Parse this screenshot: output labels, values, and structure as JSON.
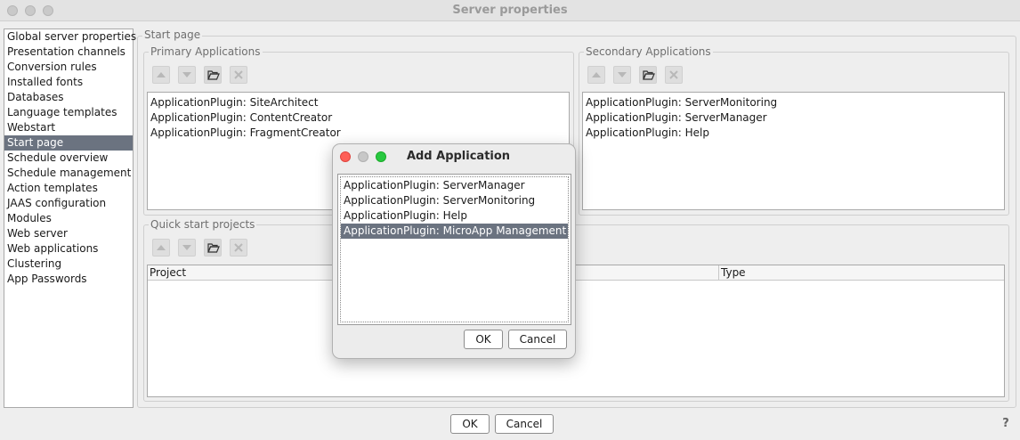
{
  "window": {
    "title": "Server properties"
  },
  "nav": {
    "items": [
      "Global server properties",
      "Presentation channels",
      "Conversion rules",
      "Installed fonts",
      "Databases",
      "Language templates",
      "Webstart",
      "Start page",
      "Schedule overview",
      "Schedule management",
      "Action templates",
      "JAAS configuration",
      "Modules",
      "Web server",
      "Web applications",
      "Clustering",
      "App Passwords"
    ],
    "selected_index": 7
  },
  "start_page": {
    "title": "Start page",
    "primary": {
      "title": "Primary Applications",
      "items": [
        "ApplicationPlugin: SiteArchitect",
        "ApplicationPlugin: ContentCreator",
        "ApplicationPlugin: FragmentCreator"
      ]
    },
    "secondary": {
      "title": "Secondary Applications",
      "items": [
        "ApplicationPlugin: ServerMonitoring",
        "ApplicationPlugin: ServerManager",
        "ApplicationPlugin: Help"
      ]
    },
    "quick_start": {
      "title": "Quick start projects",
      "columns": [
        "Project",
        "Type"
      ],
      "rows": []
    }
  },
  "toolbar_icons": [
    "move-up-icon",
    "move-down-icon",
    "folder-open-icon",
    "delete-icon"
  ],
  "dialog": {
    "title": "Add Application",
    "items": [
      "ApplicationPlugin: ServerManager",
      "ApplicationPlugin: ServerMonitoring",
      "ApplicationPlugin: Help",
      "ApplicationPlugin: MicroApp Management"
    ],
    "selected_index": 3,
    "ok_label": "OK",
    "cancel_label": "Cancel"
  },
  "footer": {
    "ok_label": "OK",
    "cancel_label": "Cancel",
    "help_label": "?"
  },
  "colors": {
    "selection": "#6b7380",
    "traffic_close": "#fe5f57",
    "traffic_min": "#c7c7c7",
    "traffic_max": "#28c840"
  }
}
